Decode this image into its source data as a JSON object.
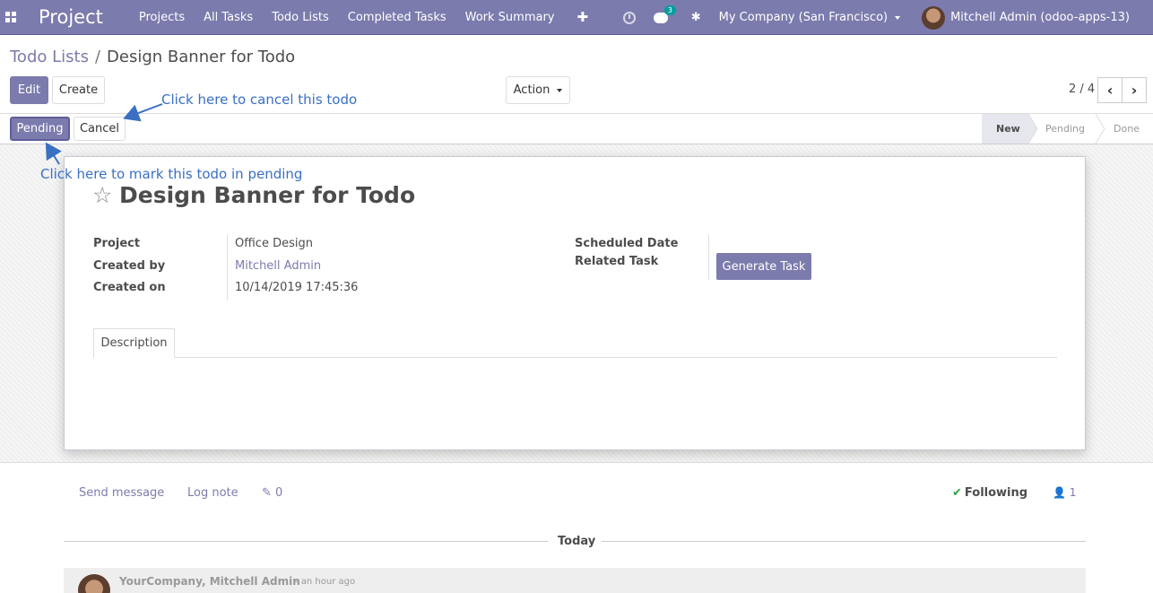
{
  "navbar": {
    "brand": "Project",
    "menu": [
      "Projects",
      "All Tasks",
      "Todo Lists",
      "Completed Tasks",
      "Work Summary"
    ],
    "plus": "✚",
    "chat_badge": "3",
    "company": "My Company (San Francisco)",
    "user": "Mitchell Admin (odoo-apps-13)"
  },
  "breadcrumb": {
    "parent": "Todo Lists",
    "separator": "/",
    "current": "Design Banner for Todo"
  },
  "buttons": {
    "edit": "Edit",
    "create": "Create",
    "action": "Action",
    "pending": "Pending",
    "cancel": "Cancel",
    "generate_task": "Generate Task"
  },
  "pager": {
    "text": "2 / 4",
    "prev": "‹",
    "next": "›"
  },
  "stages": [
    {
      "label": "New",
      "active": true
    },
    {
      "label": "Pending",
      "active": false
    },
    {
      "label": "Done",
      "active": false
    }
  ],
  "form": {
    "star": "☆",
    "title": "Design Banner for Todo",
    "fields_left": [
      {
        "label": "Project",
        "value": "Office Design",
        "link": false
      },
      {
        "label": "Created by",
        "value": "Mitchell Admin",
        "link": true
      },
      {
        "label": "Created on",
        "value": "10/14/2019 17:45:36",
        "link": false
      }
    ],
    "fields_right": [
      {
        "label": "Scheduled Date",
        "value": ""
      },
      {
        "label": "Related Task",
        "value": ""
      }
    ],
    "tab": "Description"
  },
  "chatter": {
    "send_message": "Send message",
    "log_note": "Log note",
    "attachments": "0",
    "following": "Following",
    "followers": "1",
    "today": "Today",
    "message_author": "YourCompany, Mitchell Admin",
    "message_time": "- an hour ago"
  },
  "annotations": {
    "cancel_hint": "Click here to cancel this todo",
    "pending_hint": "Click here to mark this todo in pending"
  },
  "colors": {
    "brand": "#7c7bad",
    "annotation": "#3a6fc4",
    "following_check": "#28a745"
  }
}
